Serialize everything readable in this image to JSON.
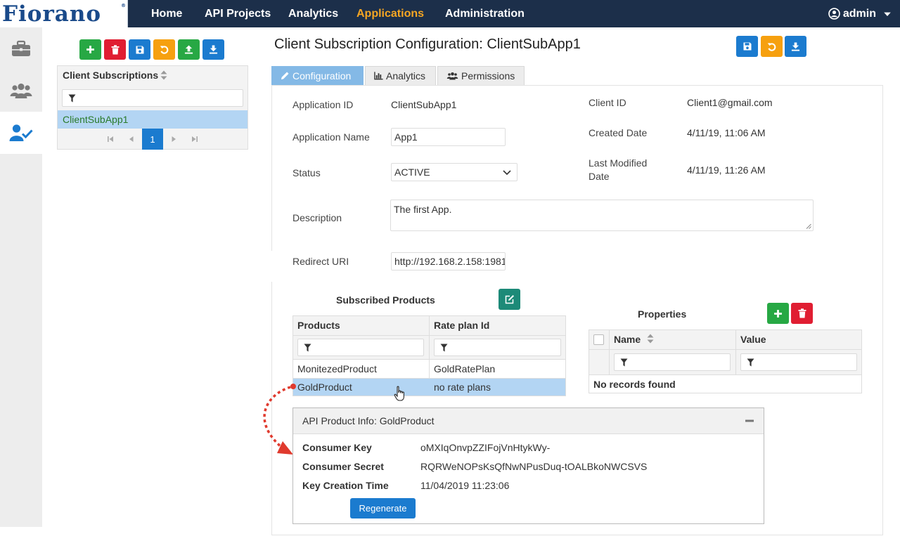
{
  "brand": {
    "name": "Fiorano",
    "mark": "®"
  },
  "nav": {
    "home": "Home",
    "api_projects": "API Projects",
    "analytics": "Analytics",
    "applications": "Applications",
    "administration": "Administration",
    "user": "admin"
  },
  "sidebar": {
    "items": [
      "briefcase-icon",
      "users-icon",
      "user-check-icon"
    ]
  },
  "left_panel": {
    "header": "Client Subscriptions",
    "rows": [
      "ClientSubApp1"
    ],
    "page": "1"
  },
  "page": {
    "title": "Client Subscription Configuration: ClientSubApp1"
  },
  "tabs": {
    "configuration": "Configuration",
    "analytics": "Analytics",
    "permissions": "Permissions"
  },
  "form": {
    "application_id_label": "Application ID",
    "application_id": "ClientSubApp1",
    "application_name_label": "Application Name",
    "application_name": "App1",
    "status_label": "Status",
    "status": "ACTIVE",
    "description_label": "Description",
    "description": "The first App.",
    "redirect_label": "Redirect URI",
    "redirect": "http://192.168.2.158:1981",
    "client_id_label": "Client ID",
    "client_id": "Client1@gmail.com",
    "created_label": "Created Date",
    "created": "4/11/19, 11:06 AM",
    "modified_label_1": "Last Modified",
    "modified_label_2": "Date",
    "modified": "4/11/19, 11:26 AM"
  },
  "subscribed": {
    "title": "Subscribed Products",
    "col_products": "Products",
    "col_rate": "Rate plan Id",
    "rows": [
      {
        "product": "MonitezedProduct",
        "rate": "GoldRatePlan"
      },
      {
        "product": "GoldProduct",
        "rate": "no rate plans"
      }
    ]
  },
  "properties": {
    "title": "Properties",
    "col_name": "Name",
    "col_value": "Value",
    "empty": "No records found"
  },
  "product_info": {
    "title": "API Product Info: GoldProduct",
    "key_label": "Consumer Key",
    "key": "oMXIqOnvpZZIFojVnHtykWy-",
    "secret_label": "Consumer Secret",
    "secret": "RQRWeNOPsKsQfNwNPusDuq-tOALBkoNWCSVS",
    "time_label": "Key Creation Time",
    "time": "11/04/2019 11:23:06",
    "regenerate": "Regenerate"
  },
  "colors": {
    "navbar": "#1c2f4a",
    "accent": "#f5a623",
    "primary": "#1b7bcf",
    "selected_row": "#b3d5f3"
  }
}
